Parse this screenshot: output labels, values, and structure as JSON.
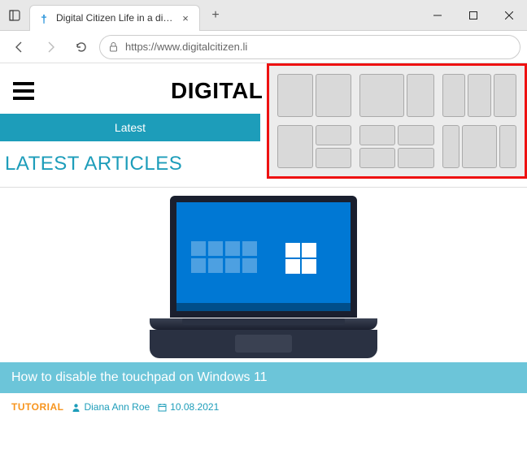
{
  "window": {
    "tab_title": "Digital Citizen Life in a digital wo",
    "url": "https://www.digitalcitizen.li"
  },
  "site": {
    "logo": "DIGITAL",
    "nav_latest": "Latest",
    "section_heading": "LATEST ARTICLES"
  },
  "article": {
    "title": "How to disable the touchpad on Windows 11",
    "category": "TUTORIAL",
    "author": "Diana Ann Roe",
    "date": "10.08.2021"
  },
  "icons": {
    "close": "×",
    "plus": "+"
  }
}
